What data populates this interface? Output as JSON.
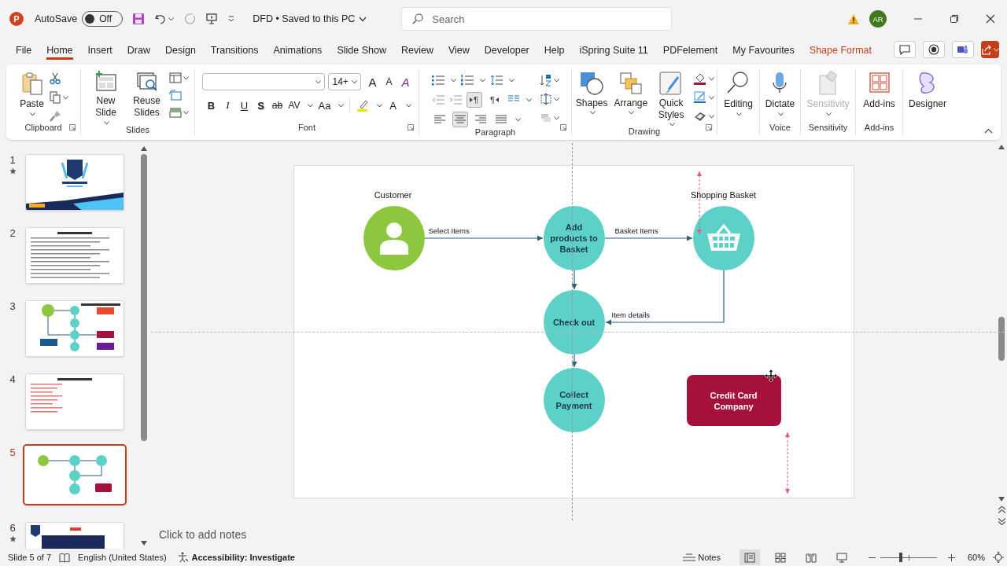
{
  "title_bar": {
    "app_logo": "P",
    "autosave": {
      "label": "AutoSave",
      "state": "Off",
      "on": false
    },
    "document": "DFD",
    "separator": "•",
    "save_status": "Saved to this PC",
    "search": {
      "placeholder": "Search"
    },
    "account": {
      "initials": "AR"
    }
  },
  "tabs": [
    {
      "label": "File",
      "selected": false,
      "kind": "normal"
    },
    {
      "label": "Home",
      "selected": true,
      "kind": "normal"
    },
    {
      "label": "Insert",
      "selected": false,
      "kind": "normal"
    },
    {
      "label": "Draw",
      "selected": false,
      "kind": "normal"
    },
    {
      "label": "Design",
      "selected": false,
      "kind": "normal"
    },
    {
      "label": "Transitions",
      "selected": false,
      "kind": "normal"
    },
    {
      "label": "Animations",
      "selected": false,
      "kind": "normal"
    },
    {
      "label": "Slide Show",
      "selected": false,
      "kind": "normal"
    },
    {
      "label": "Review",
      "selected": false,
      "kind": "normal"
    },
    {
      "label": "View",
      "selected": false,
      "kind": "normal"
    },
    {
      "label": "Developer",
      "selected": false,
      "kind": "normal"
    },
    {
      "label": "Help",
      "selected": false,
      "kind": "normal"
    },
    {
      "label": "iSpring Suite 11",
      "selected": false,
      "kind": "normal"
    },
    {
      "label": "PDFelement",
      "selected": false,
      "kind": "normal"
    },
    {
      "label": "My Favourites",
      "selected": false,
      "kind": "normal"
    },
    {
      "label": "Shape Format",
      "selected": false,
      "kind": "contextual"
    }
  ],
  "ribbon": {
    "clipboard": {
      "label": "Clipboard",
      "paste": "Paste"
    },
    "slides": {
      "label": "Slides",
      "new_slide": "New Slide",
      "reuse_slides": "Reuse Slides"
    },
    "font": {
      "label": "Font",
      "size": "14+",
      "size_buttons": [
        {
          "text": "A",
          "kind": "grow"
        },
        {
          "text": "A",
          "kind": "shrink"
        },
        {
          "text": "A",
          "kind": "clear"
        }
      ],
      "format_buttons": [
        {
          "text": "B",
          "kind": "bold"
        },
        {
          "text": "I",
          "kind": "italic"
        },
        {
          "text": "U",
          "kind": "underline"
        },
        {
          "text": "S",
          "kind": "shadow"
        },
        {
          "text": "ab",
          "kind": "strike"
        },
        {
          "text": "AV",
          "kind": "spacing"
        },
        {
          "text": "Aa",
          "kind": "case"
        },
        {
          "kind": "highlight"
        },
        {
          "text": "A",
          "kind": "color"
        }
      ]
    },
    "paragraph": {
      "label": "Paragraph",
      "direction": [
        {
          "text": "¶",
          "kind": "ltr",
          "selected": true
        },
        {
          "text": "¶",
          "kind": "rtl",
          "selected": false
        }
      ],
      "alignment": [
        {
          "kind": "left",
          "selected": false
        },
        {
          "kind": "center",
          "selected": true
        },
        {
          "kind": "right",
          "selected": false
        },
        {
          "kind": "justify",
          "selected": false
        }
      ]
    },
    "drawing": {
      "label": "Drawing",
      "buttons": [
        {
          "label": "Shapes",
          "kind": "shapes"
        },
        {
          "label": "Arrange",
          "kind": "arrange"
        },
        {
          "label": "Quick Styles",
          "kind": "styles"
        }
      ]
    },
    "editing": {
      "button": "Editing"
    },
    "voice": {
      "label": "Voice",
      "button": "Dictate"
    },
    "sensitivity": {
      "label": "Sensitivity",
      "button": "Sensitivity",
      "disabled": true
    },
    "addins": {
      "label": "Add-ins",
      "button": "Add-ins"
    },
    "designer": {
      "button": "Designer"
    }
  },
  "slides": [
    {
      "number": "1",
      "starred": true,
      "selected": false,
      "kind": "title"
    },
    {
      "number": "2",
      "starred": false,
      "selected": false,
      "kind": "list"
    },
    {
      "number": "3",
      "starred": false,
      "selected": false,
      "kind": "workflow"
    },
    {
      "number": "4",
      "starred": false,
      "selected": false,
      "kind": "red-list"
    },
    {
      "number": "5",
      "starred": false,
      "selected": true,
      "kind": "dfd"
    },
    {
      "number": "6",
      "starred": true,
      "selected": false,
      "kind": "promo"
    }
  ],
  "slide": {
    "nodes": [
      {
        "kind": "person",
        "caption": "Customer",
        "color": "#8dc63f"
      },
      {
        "kind": "process",
        "label": "Add products to Basket",
        "color": "#5dd0c8"
      },
      {
        "kind": "basket",
        "caption": "Shopping Basket",
        "color": "#5dd0c8"
      },
      {
        "kind": "process",
        "label": "Check out",
        "color": "#5dd0c8"
      },
      {
        "kind": "process",
        "label": "Collect Payment",
        "color": "#5dd0c8"
      },
      {
        "kind": "external",
        "label": "Credit Card Company",
        "color": "#a6113c"
      }
    ],
    "flows": [
      {
        "label": "Select Items"
      },
      {
        "label": "Basket Items"
      },
      {
        "label": "Item details"
      }
    ]
  },
  "notes": {
    "placeholder": "Click to add notes"
  },
  "status_bar": {
    "slide_position": "Slide 5 of 7",
    "language": "English (United States)",
    "accessibility": "Accessibility: Investigate",
    "notes": "Notes",
    "views": [
      {
        "kind": "normal",
        "selected": true
      },
      {
        "kind": "sorter",
        "selected": false
      },
      {
        "kind": "reading",
        "selected": false
      },
      {
        "kind": "show",
        "selected": false
      }
    ],
    "zoom": {
      "level": 0.36,
      "reading": "60%"
    }
  }
}
